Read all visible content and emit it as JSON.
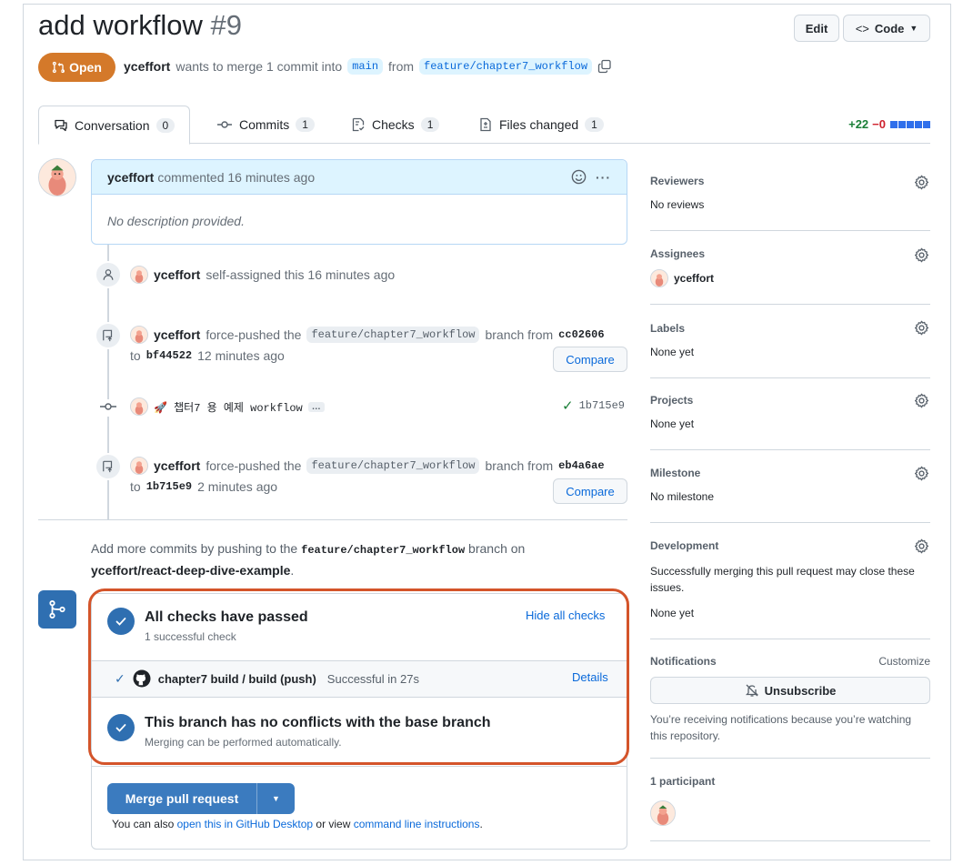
{
  "header": {
    "title": "add workflow",
    "number": "#9",
    "edit_label": "Edit",
    "code_label": "Code",
    "state": "Open",
    "author": "yceffort",
    "merge_text": "wants to merge 1 commit into",
    "base_branch": "main",
    "from_text": "from",
    "head_branch": "feature/chapter7_workflow"
  },
  "tabs": [
    {
      "label": "Conversation",
      "count": "0"
    },
    {
      "label": "Commits",
      "count": "1"
    },
    {
      "label": "Checks",
      "count": "1"
    },
    {
      "label": "Files changed",
      "count": "1"
    }
  ],
  "diffstat": {
    "added": "+22",
    "removed": "−0"
  },
  "comment": {
    "author": "yceffort",
    "action": "commented 16 minutes ago",
    "body": "No description provided."
  },
  "events": {
    "assigned": {
      "author": "yceffort",
      "text": "self-assigned this 16 minutes ago"
    },
    "push1": {
      "author": "yceffort",
      "text1": "force-pushed the",
      "branch": "feature/chapter7_workflow",
      "text2": "branch from",
      "from_sha": "cc02606",
      "to_text": "to",
      "to_sha": "bf44522",
      "time": "12 minutes ago",
      "compare": "Compare"
    },
    "commit": {
      "message": "🚀 챕터7 용 예제 workflow",
      "more": "…",
      "sha": "1b715e9"
    },
    "push2": {
      "author": "yceffort",
      "text1": "force-pushed the",
      "branch": "feature/chapter7_workflow",
      "text2": "branch from",
      "from_sha": "eb4a6ae",
      "to_text": "to",
      "to_sha": "1b715e9",
      "time": "2 minutes ago",
      "compare": "Compare"
    }
  },
  "add_more": {
    "text1": "Add more commits by pushing to the",
    "branch": "feature/chapter7_workflow",
    "text2": "branch on",
    "repo": "yceffort/react-deep-dive-example",
    "period": "."
  },
  "merge": {
    "checks_title": "All checks have passed",
    "checks_sub": "1 successful check",
    "hide_checks": "Hide all checks",
    "check_name": "chapter7 build / build (push)",
    "check_status": "Successful in 27s",
    "details": "Details",
    "conflict_title": "This branch has no conflicts with the base branch",
    "conflict_sub": "Merging can be performed automatically.",
    "merge_button": "Merge pull request",
    "also_text1": "You can also",
    "desktop_link": "open this in GitHub Desktop",
    "also_text2": "or view",
    "cli_link": "command line instructions",
    "period": "."
  },
  "sidebar": {
    "reviewers": {
      "label": "Reviewers",
      "value": "No reviews"
    },
    "assignees": {
      "label": "Assignees",
      "value": "yceffort"
    },
    "labels": {
      "label": "Labels",
      "value": "None yet"
    },
    "projects": {
      "label": "Projects",
      "value": "None yet"
    },
    "milestone": {
      "label": "Milestone",
      "value": "No milestone"
    },
    "development": {
      "label": "Development",
      "text": "Successfully merging this pull request may close these issues.",
      "value": "None yet"
    },
    "notifications": {
      "label": "Notifications",
      "customize": "Customize",
      "button": "Unsubscribe",
      "text": "You’re receiving notifications because you’re watching this repository."
    },
    "participants": {
      "label": "1 participant"
    }
  },
  "colors": {
    "accent": "#0969da",
    "open": "#d4792a",
    "merge": "#3b7bbf",
    "highlight": "#d4542a"
  }
}
